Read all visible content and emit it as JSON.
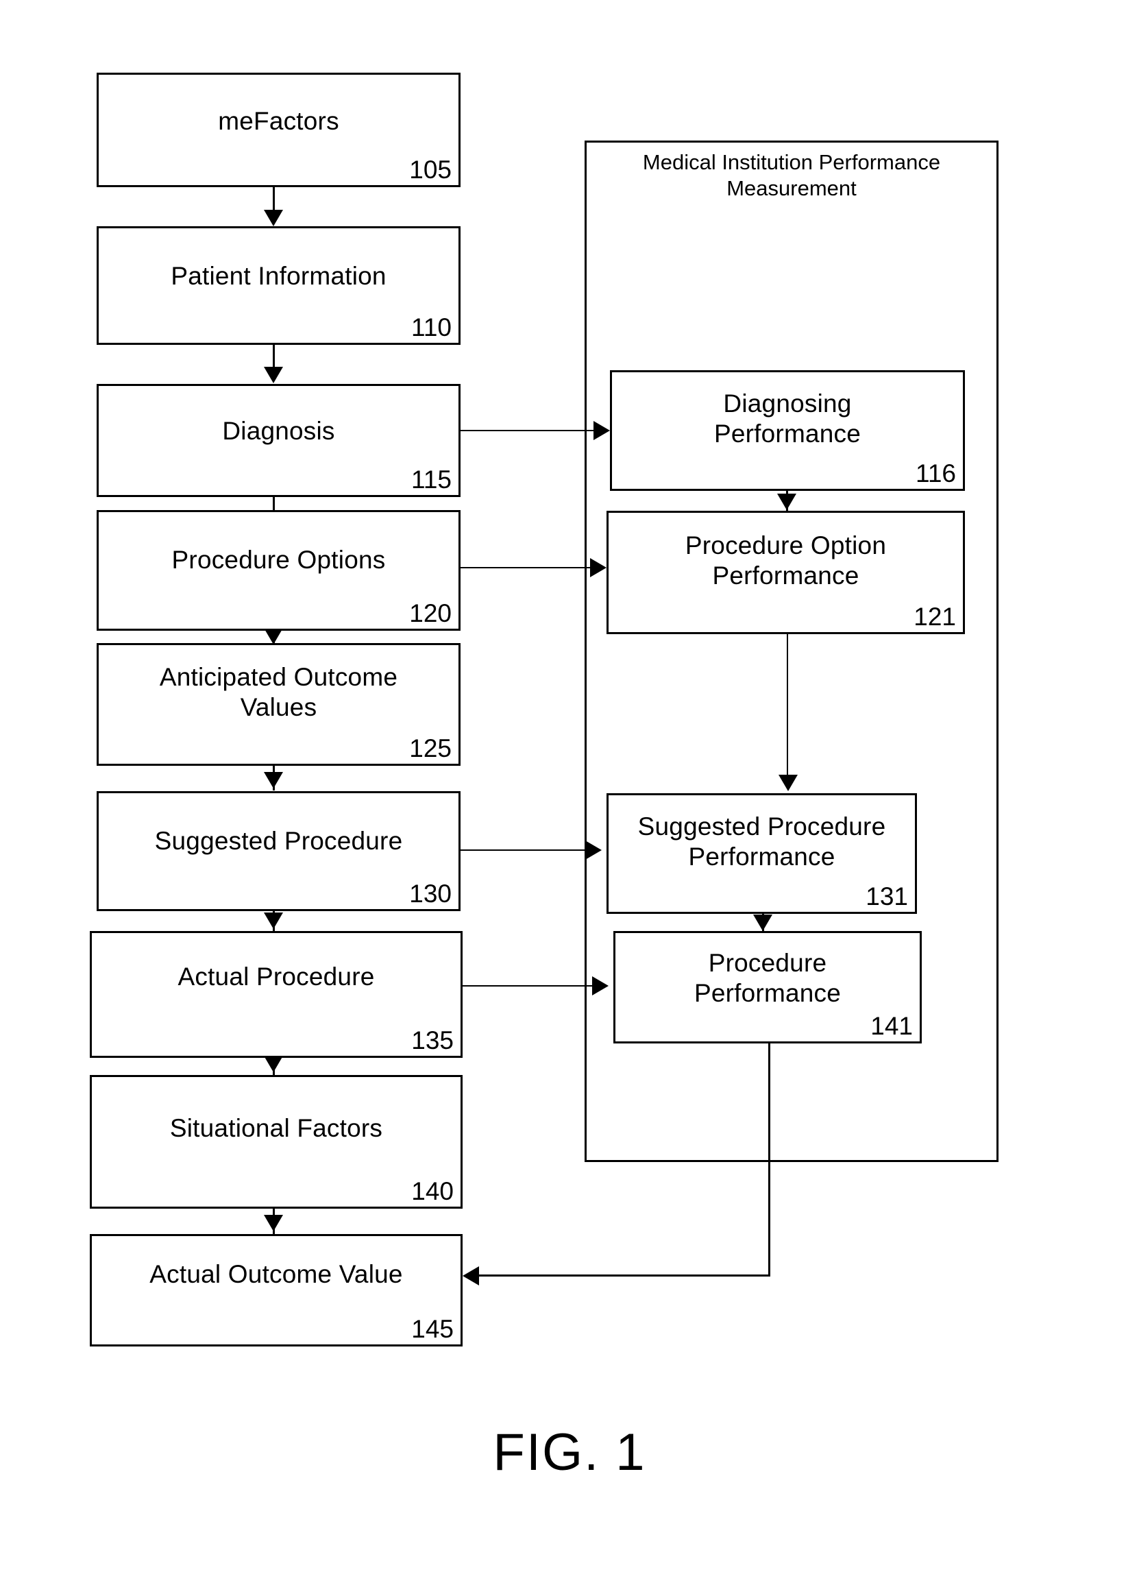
{
  "figure": {
    "caption": "FIG. 1",
    "panel": {
      "title": "Medical Institution Performance\nMeasurement"
    },
    "left_column": [
      {
        "label": "meFactors",
        "ref": "105"
      },
      {
        "label": "Patient Information",
        "ref": "110"
      },
      {
        "label": "Diagnosis",
        "ref": "115"
      },
      {
        "label": "Procedure Options",
        "ref": "120"
      },
      {
        "label": "Anticipated Outcome\nValues",
        "ref": "125"
      },
      {
        "label": "Suggested Procedure",
        "ref": "130"
      },
      {
        "label": "Actual Procedure",
        "ref": "135"
      },
      {
        "label": "Situational Factors",
        "ref": "140"
      },
      {
        "label": "Actual Outcome Value",
        "ref": "145"
      }
    ],
    "right_column": [
      {
        "label": "Diagnosing\nPerformance",
        "ref": "116"
      },
      {
        "label": "Procedure Option\nPerformance",
        "ref": "121"
      },
      {
        "label": "Suggested Procedure\nPerformance",
        "ref": "131"
      },
      {
        "label": "Procedure\nPerformance",
        "ref": "141"
      }
    ],
    "colors": {
      "stroke": "#000000",
      "fill": "#ffffff"
    }
  }
}
